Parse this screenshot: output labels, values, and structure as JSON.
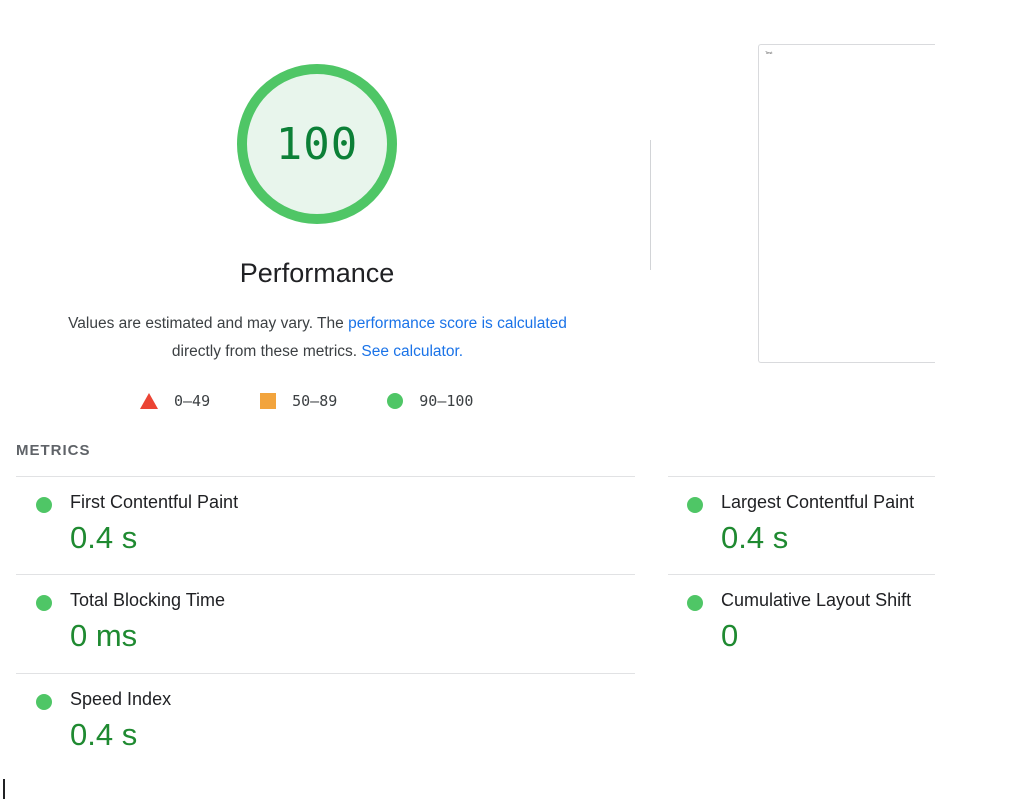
{
  "gauge": {
    "score": "100",
    "fraction": 1.0,
    "ring_color": "#4fc666",
    "fill_color": "#e8f5ec",
    "text_color": "#0c8037"
  },
  "category": {
    "title": "Performance"
  },
  "description": {
    "part1": "Values are estimated and may vary. The ",
    "link1": "performance score is calculated",
    "part2": " directly from these metrics. ",
    "link2": "See calculator."
  },
  "legend": {
    "fail": "0–49",
    "average": "50–89",
    "pass": "90–100"
  },
  "screenshot": {
    "text": "Test"
  },
  "metrics": {
    "header": "METRICS",
    "fcp": {
      "title": "First Contentful Paint",
      "value": "0.4 s"
    },
    "lcp": {
      "title": "Largest Contentful Paint",
      "value": "0.4 s"
    },
    "tbt": {
      "title": "Total Blocking Time",
      "value": "0 ms"
    },
    "cls": {
      "title": "Cumulative Layout Shift",
      "value": "0"
    },
    "si": {
      "title": "Speed Index",
      "value": "0.4 s"
    }
  },
  "colors": {
    "pass": "#4fc666",
    "average": "#f2a43d",
    "fail": "#eb4434",
    "link": "#1a73e8",
    "metric_value": "#1f8a31"
  }
}
